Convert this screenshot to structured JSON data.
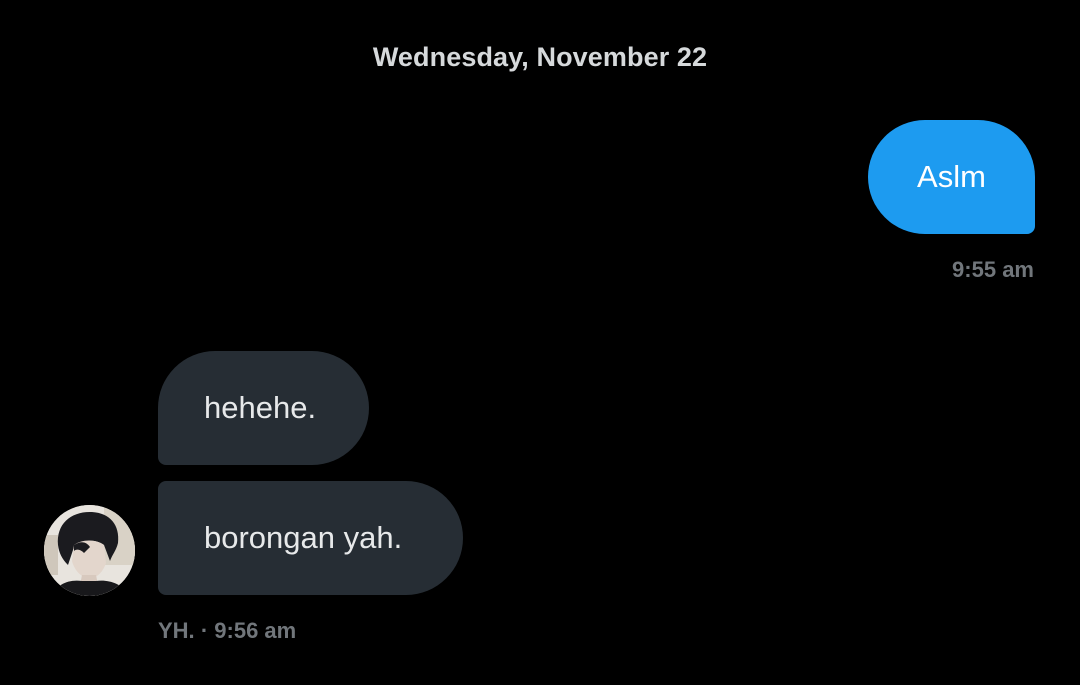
{
  "conversation": {
    "date_separator": "Wednesday, November 22",
    "messages": [
      {
        "direction": "sent",
        "text": "Aslm",
        "time": "9:55 am"
      },
      {
        "direction": "received",
        "text": "hehehe."
      },
      {
        "direction": "received",
        "text": "borongan yah."
      }
    ],
    "received_meta": {
      "sender": "YH.",
      "separator": "·",
      "time": "9:56 am"
    }
  },
  "colors": {
    "background": "#000000",
    "sent_bubble": "#1d9bf0",
    "received_bubble": "#262d34",
    "meta_text": "#71767b"
  },
  "avatar": {
    "icon": "user-avatar-photo"
  }
}
